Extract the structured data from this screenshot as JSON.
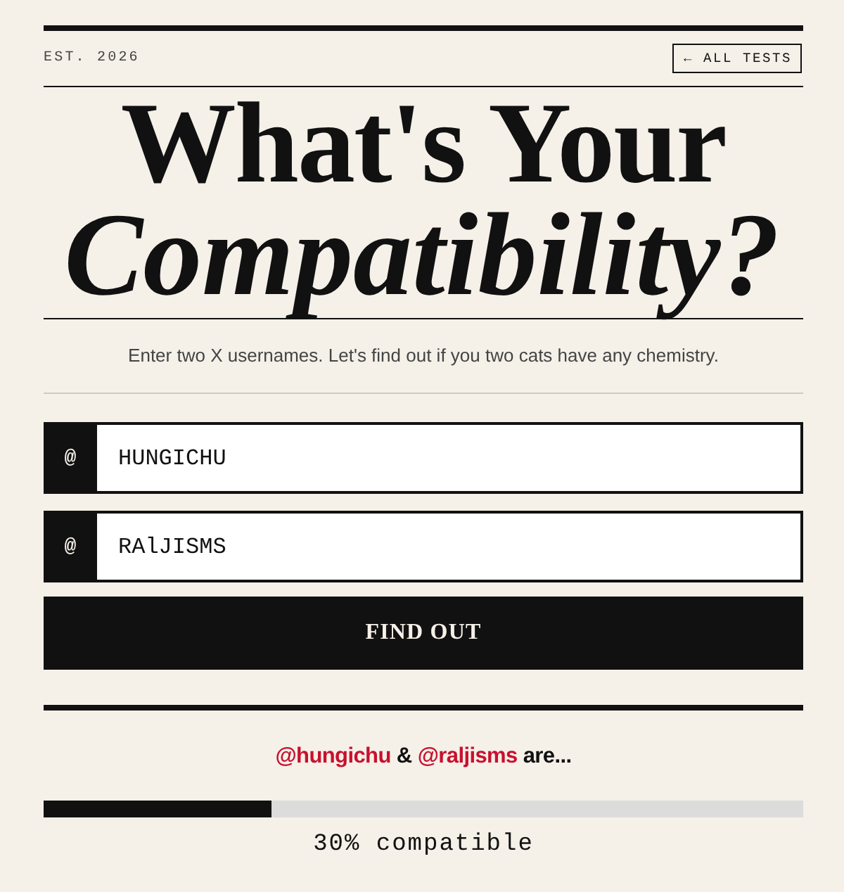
{
  "header": {
    "established": "EST. 2026",
    "back_link": "← ALL TESTS"
  },
  "title": {
    "line_1": "What's Your",
    "line_2": "Compatibility?"
  },
  "subtitle": "Enter two X usernames. Let's find out if you two cats have any chemistry.",
  "fields": [
    {
      "prefix": "@",
      "value": "HUNGICHU"
    },
    {
      "prefix": "@",
      "value": "RAlJISMS"
    }
  ],
  "submit_button": "FIND OUT",
  "result": {
    "user_a": "@hungichu",
    "joiner": "&",
    "user_b": "@raljisms",
    "tail": "are...",
    "level": 0.3,
    "reading": "30% compatible"
  }
}
